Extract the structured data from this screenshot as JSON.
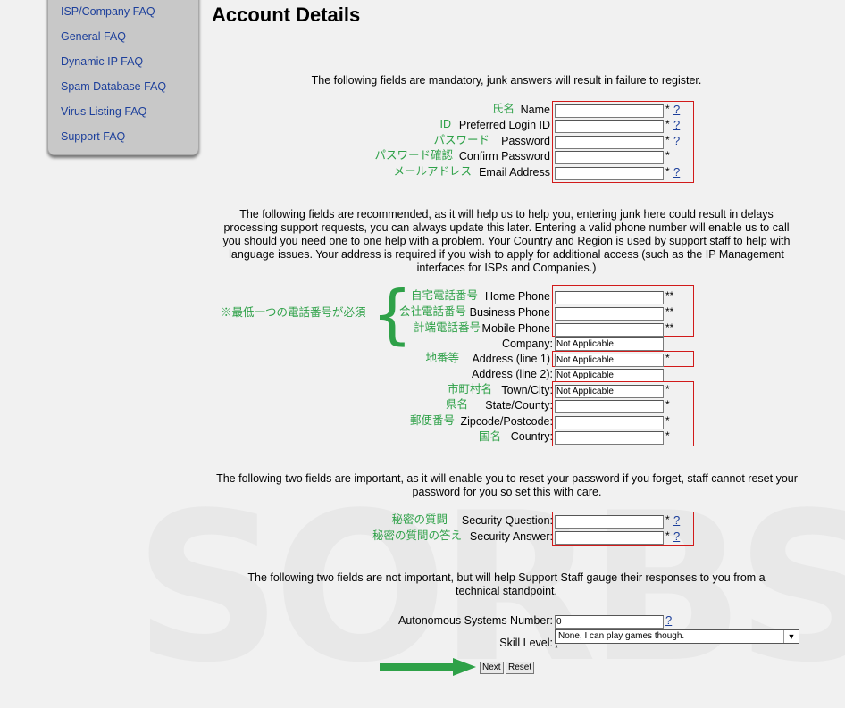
{
  "sidebar": {
    "items": [
      {
        "label": "ISP/Company FAQ"
      },
      {
        "label": "General FAQ"
      },
      {
        "label": "Dynamic IP FAQ"
      },
      {
        "label": "Spam Database FAQ"
      },
      {
        "label": "Virus Listing FAQ"
      },
      {
        "label": "Support FAQ"
      }
    ]
  },
  "page": {
    "title": "Account Details"
  },
  "watermark": {
    "text": "SORBS"
  },
  "sections": {
    "mandatory": "The following fields are mandatory, junk answers will result in failure to register.",
    "recommended": "The following fields are recommended, as it will help us to help you, entering junk here could result in delays processing support requests, you can always update this later. Entering a valid phone number will enable us to call you should you need one to one help with a problem. Your Country and Region is used by support staff to help with language issues. Your address is required if you wish to apply for additional access (such as the IP Management interfaces for ISPs and Companies.)",
    "important": "The following two fields are important, as it will enable you to reset your password if you forget, staff cannot reset your password for you so set this with care.",
    "not_important": "The following two fields are not important, but will help Support Staff gauge their responses to you from a technical standpoint."
  },
  "phone_note": "※最低一つの電話番号が必須",
  "fields": {
    "name": {
      "jp": "氏名",
      "label": "Name",
      "value": "",
      "star": "*",
      "help": "?"
    },
    "login": {
      "jp": "ID",
      "label": "Preferred Login ID",
      "value": "",
      "star": "*",
      "help": "?"
    },
    "password": {
      "jp": "パスワード",
      "label": "Password",
      "value": "",
      "star": "*",
      "help": "?"
    },
    "confirm": {
      "jp": "パスワード確認",
      "label": "Confirm Password",
      "value": "",
      "star": "*"
    },
    "email": {
      "jp": "メールアドレス",
      "label": "Email Address",
      "value": "",
      "star": "*",
      "help": "?"
    },
    "home_phone": {
      "jp": "自宅電話番号",
      "label": "Home Phone",
      "value": "",
      "star": "**"
    },
    "business_phone": {
      "jp": "会社電話番号",
      "label": "Business Phone",
      "value": "",
      "star": "**"
    },
    "mobile_phone": {
      "jp": "計端電話番号",
      "label": "Mobile Phone",
      "value": "",
      "star": "**"
    },
    "company": {
      "label": "Company:",
      "value": "Not Applicable"
    },
    "address1": {
      "jp": "地番等",
      "label": "Address (line 1)",
      "value": "Not Applicable",
      "star": "*"
    },
    "address2": {
      "label": "Address (line 2):",
      "value": "Not Applicable"
    },
    "town": {
      "jp": "市町村名",
      "label": "Town/City:",
      "value": "Not Applicable",
      "star": "*"
    },
    "state": {
      "jp": "県名",
      "label": "State/County:",
      "value": "",
      "star": "*"
    },
    "zip": {
      "jp": "郵便番号",
      "label": "Zipcode/Postcode:",
      "value": "",
      "star": "*"
    },
    "country": {
      "jp": "国名",
      "label": "Country:",
      "value": "",
      "star": "*"
    },
    "sec_q": {
      "jp": "秘密の質問",
      "label": "Security Question:",
      "value": "",
      "star": "*",
      "help": "?"
    },
    "sec_a": {
      "jp": "秘密の質問の答え",
      "label": "Security Answer:",
      "value": "",
      "star": "*",
      "help": "?"
    },
    "asn": {
      "label": "Autonomous Systems Number:",
      "value": "0",
      "help": "?"
    },
    "skill": {
      "label": "Skill Level:",
      "value": "None, I can play games though.",
      "star": "*"
    }
  },
  "buttons": {
    "next": "Next",
    "reset": "Reset"
  },
  "colors": {
    "link": "#1c3f9b",
    "japanese": "#2ea148",
    "required_box": "#d11a1a",
    "arrow": "#2ea148"
  }
}
